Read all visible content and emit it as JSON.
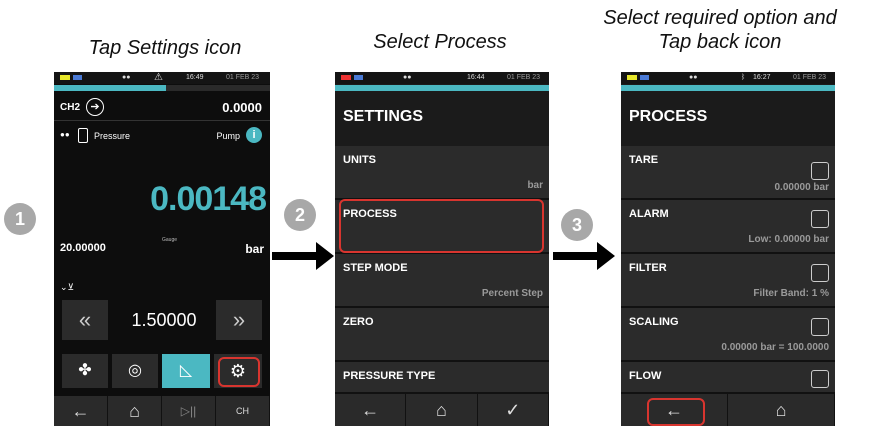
{
  "captions": {
    "step1": "Tap Settings icon",
    "step2": "Select Process",
    "step3_line1": "Select required option and",
    "step3_line2": "Tap back icon"
  },
  "steps": [
    "1",
    "2",
    "3"
  ],
  "phone1": {
    "time": "16:49",
    "date": "01 FEB 23",
    "channel": "CH2",
    "channel_value": "0.0000",
    "mode": "Pressure",
    "pump": "Pump",
    "reading": "0.00148",
    "range_value": "20.00000",
    "range_type": "Gauge",
    "unit": "bar",
    "setpoint": "1.50000",
    "icons": [
      "fan-icon",
      "pump-icon",
      "gauge-icon",
      "gear-icon"
    ],
    "nav": [
      "back-arrow-icon",
      "home-icon",
      "play-pause-icon",
      "channel-home-icon"
    ],
    "nav_channel_label": "CH"
  },
  "phone2": {
    "time": "16:44",
    "date": "01 FEB 23",
    "title": "SETTINGS",
    "items": [
      {
        "label": "UNITS",
        "value": "bar"
      },
      {
        "label": "PROCESS",
        "value": ""
      },
      {
        "label": "STEP MODE",
        "value": "Percent Step"
      },
      {
        "label": "ZERO",
        "value": ""
      },
      {
        "label": "PRESSURE TYPE",
        "value": ""
      }
    ]
  },
  "phone3": {
    "time": "16:27",
    "date": "01 FEB 23",
    "title": "PROCESS",
    "items": [
      {
        "label": "TARE",
        "value": "0.00000 bar"
      },
      {
        "label": "ALARM",
        "value": "Low: 0.00000 bar"
      },
      {
        "label": "FILTER",
        "value": "Filter Band: 1 %"
      },
      {
        "label": "SCALING",
        "value": "0.00000 bar = 100.0000"
      },
      {
        "label": "FLOW",
        "value": ""
      }
    ]
  },
  "colors": {
    "teal": "#4bb8c2",
    "highlight": "#d8352f",
    "step_badge": "#a8a8a8"
  }
}
